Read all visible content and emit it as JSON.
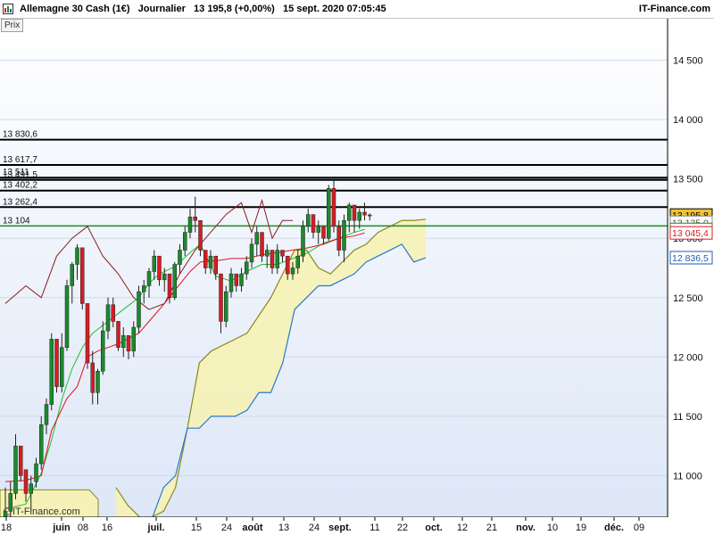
{
  "header": {
    "instrument": "Allemagne 30 Cash (1€)",
    "period": "Journalier",
    "quote": "13 195,8 (+0,00%)",
    "datetime": "15 sept. 2020 07:05:45",
    "brand": "IT-Finance.com"
  },
  "panel_label": "Prix",
  "watermark": "IT-Finance.com",
  "colors": {
    "background_top": "#ffffff",
    "background_bottom": "#dde7f7",
    "candle_up": "#1b8a2c",
    "candle_down": "#d81c22",
    "wick": "#222222",
    "tenkan": "#e3101e",
    "kijun": "#1fbf2e",
    "chikou": "#8b1c1c",
    "senkou_a": "#888a1d",
    "senkou_b": "#2878d0",
    "cloud_fill": "#f6f1b8",
    "level_line": "#000000",
    "green_level": "#1f8a1f"
  },
  "chart_data": {
    "type": "candlestick",
    "indicator": "Ichimoku",
    "y_axis": {
      "range": [
        10650,
        14850
      ],
      "ticks": [
        11000,
        11500,
        12000,
        12500,
        13000,
        13500,
        14000,
        14500
      ]
    },
    "x_axis": {
      "ticks": [
        {
          "label": "18",
          "bold": false
        },
        {
          "label": "juin",
          "bold": true
        },
        {
          "label": "08",
          "bold": false
        },
        {
          "label": "16",
          "bold": false
        },
        {
          "label": "juil.",
          "bold": true
        },
        {
          "label": "15",
          "bold": false
        },
        {
          "label": "24",
          "bold": false
        },
        {
          "label": "août",
          "bold": true
        },
        {
          "label": "13",
          "bold": false
        },
        {
          "label": "24",
          "bold": false
        },
        {
          "label": "sept.",
          "bold": true
        },
        {
          "label": "11",
          "bold": false
        },
        {
          "label": "22",
          "bold": false
        },
        {
          "label": "oct.",
          "bold": true
        },
        {
          "label": "12",
          "bold": false
        },
        {
          "label": "21",
          "bold": false
        },
        {
          "label": "nov.",
          "bold": true
        },
        {
          "label": "10",
          "bold": false
        },
        {
          "label": "19",
          "bold": false
        },
        {
          "label": "déc.",
          "bold": true
        },
        {
          "label": "09",
          "bold": false
        }
      ]
    },
    "horizontal_levels": [
      {
        "label": "13 830,6",
        "value": 13830.6,
        "color": "#000000"
      },
      {
        "label": "13 617,7",
        "value": 13617.7,
        "color": "#000000"
      },
      {
        "label": "13 511",
        "value": 13511,
        "color": "#000000"
      },
      {
        "label": "13 491,5",
        "value": 13491.5,
        "color": "#000000"
      },
      {
        "label": "13 402,2",
        "value": 13402.2,
        "color": "#000000"
      },
      {
        "label": "13 262,4",
        "value": 13262.4,
        "color": "#000000"
      },
      {
        "label": "13 104",
        "value": 13104,
        "color": "#1f8a1f"
      }
    ],
    "price_badges": [
      {
        "label": "13 195,8",
        "value": 13195.8,
        "bg": "#f2c230",
        "fg": "#000000",
        "border": "#000000"
      },
      {
        "label": "13 135,0",
        "value": 13135,
        "bg": "#ffffff",
        "fg": "#555555",
        "border": "#888888"
      },
      {
        "label": "13 074,7",
        "value": 13074.7,
        "bg": "#ffffff",
        "fg": "#1f8a1f",
        "border": "#1f8a1f"
      },
      {
        "label": "13 045,4",
        "value": 13045.4,
        "bg": "#ffffff",
        "fg": "#d81c22",
        "border": "#d81c22"
      },
      {
        "label": "12 836,5",
        "value": 12836.5,
        "bg": "#ffffff",
        "fg": "#1d5fb8",
        "border": "#1d5fb8"
      }
    ],
    "candles": [
      [
        10650,
        10900,
        10400,
        10700
      ],
      [
        10700,
        10950,
        10650,
        10850
      ],
      [
        10850,
        11350,
        10800,
        11250
      ],
      [
        11250,
        11200,
        10950,
        11000
      ],
      [
        11050,
        11000,
        10780,
        10850
      ],
      [
        10850,
        11000,
        10700,
        10930
      ],
      [
        10950,
        11150,
        10900,
        11100
      ],
      [
        11100,
        11500,
        11050,
        11430
      ],
      [
        11430,
        11650,
        11350,
        11600
      ],
      [
        11600,
        12200,
        11550,
        12150
      ],
      [
        12150,
        12100,
        11700,
        11750
      ],
      [
        11750,
        12200,
        11700,
        12080
      ],
      [
        12080,
        12650,
        12050,
        12600
      ],
      [
        12600,
        12800,
        12450,
        12780
      ],
      [
        12780,
        12950,
        12650,
        12920
      ],
      [
        12920,
        12550,
        12400,
        12450
      ],
      [
        12450,
        12200,
        11900,
        11950
      ],
      [
        11950,
        12050,
        11600,
        11700
      ],
      [
        11700,
        11900,
        11600,
        11880
      ],
      [
        11880,
        12300,
        11850,
        12220
      ],
      [
        12220,
        12500,
        12150,
        12440
      ],
      [
        12440,
        12500,
        12250,
        12300
      ],
      [
        12300,
        12200,
        12050,
        12080
      ],
      [
        12080,
        12250,
        12000,
        12180
      ],
      [
        12180,
        12150,
        11980,
        12050
      ],
      [
        12050,
        12300,
        12000,
        12250
      ],
      [
        12250,
        12600,
        12200,
        12550
      ],
      [
        12550,
        12650,
        12450,
        12600
      ],
      [
        12600,
        12750,
        12500,
        12720
      ],
      [
        12720,
        12900,
        12650,
        12850
      ],
      [
        12850,
        12800,
        12600,
        12650
      ],
      [
        12650,
        12750,
        12550,
        12700
      ],
      [
        12700,
        12550,
        12450,
        12500
      ],
      [
        12500,
        12800,
        12480,
        12780
      ],
      [
        12780,
        12950,
        12700,
        12900
      ],
      [
        12900,
        13100,
        12850,
        13050
      ],
      [
        13050,
        13250,
        13000,
        13180
      ],
      [
        13180,
        13350,
        13050,
        13150
      ],
      [
        13150,
        12950,
        12850,
        12900
      ],
      [
        12900,
        12800,
        12700,
        12750
      ],
      [
        12750,
        12900,
        12700,
        12850
      ],
      [
        12850,
        12750,
        12650,
        12700
      ],
      [
        12700,
        12350,
        12200,
        12300
      ],
      [
        12300,
        12600,
        12250,
        12550
      ],
      [
        12550,
        12750,
        12500,
        12700
      ],
      [
        12700,
        12650,
        12550,
        12600
      ],
      [
        12600,
        12750,
        12550,
        12700
      ],
      [
        12700,
        12850,
        12650,
        12800
      ],
      [
        12800,
        13000,
        12750,
        12950
      ],
      [
        12950,
        13100,
        12850,
        13050
      ],
      [
        13050,
        12900,
        12800,
        12850
      ],
      [
        12850,
        12950,
        12750,
        12900
      ],
      [
        12900,
        12800,
        12700,
        12750
      ],
      [
        12750,
        12950,
        12700,
        12900
      ],
      [
        12900,
        12850,
        12800,
        12850
      ],
      [
        12850,
        12800,
        12650,
        12700
      ],
      [
        12700,
        12800,
        12650,
        12750
      ],
      [
        12750,
        12900,
        12700,
        12850
      ],
      [
        12850,
        13150,
        12800,
        13100
      ],
      [
        13100,
        13250,
        13050,
        13200
      ],
      [
        13200,
        13150,
        13000,
        13050
      ],
      [
        13050,
        13150,
        12950,
        13100
      ],
      [
        13100,
        13050,
        12950,
        13000
      ],
      [
        13000,
        13450,
        12980,
        13420
      ],
      [
        13420,
        13500,
        13050,
        13100
      ],
      [
        13100,
        13150,
        12850,
        12900
      ],
      [
        12900,
        13200,
        12800,
        13150
      ],
      [
        13150,
        13300,
        13050,
        13280
      ],
      [
        13280,
        13100,
        13050,
        13150
      ],
      [
        13150,
        13250,
        13080,
        13220
      ],
      [
        13220,
        13300,
        13150,
        13196
      ],
      [
        13196,
        13210,
        13150,
        13196
      ]
    ],
    "tenkan": [
      [
        0,
        10950
      ],
      [
        4,
        10960
      ],
      [
        7,
        11000
      ],
      [
        9,
        11380
      ],
      [
        12,
        11650
      ],
      [
        14,
        11750
      ],
      [
        16,
        12000
      ],
      [
        18,
        12050
      ],
      [
        20,
        12080
      ],
      [
        22,
        12110
      ],
      [
        26,
        12200
      ],
      [
        29,
        12350
      ],
      [
        31,
        12450
      ],
      [
        33,
        12560
      ],
      [
        36,
        12720
      ],
      [
        38,
        12800
      ],
      [
        41,
        12810
      ],
      [
        44,
        12830
      ],
      [
        47,
        12830
      ],
      [
        50,
        12860
      ],
      [
        53,
        12880
      ],
      [
        56,
        12900
      ],
      [
        59,
        12920
      ],
      [
        62,
        12950
      ],
      [
        65,
        13000
      ],
      [
        68,
        13020
      ],
      [
        70,
        13045
      ]
    ],
    "kijun": [
      [
        0,
        10720
      ],
      [
        4,
        10760
      ],
      [
        7,
        11020
      ],
      [
        9,
        11300
      ],
      [
        11,
        11640
      ],
      [
        13,
        11900
      ],
      [
        15,
        12080
      ],
      [
        17,
        12200
      ],
      [
        20,
        12300
      ],
      [
        23,
        12400
      ],
      [
        26,
        12500
      ],
      [
        28,
        12620
      ],
      [
        30,
        12700
      ],
      [
        33,
        12760
      ],
      [
        36,
        12880
      ],
      [
        38,
        12950
      ],
      [
        41,
        12680
      ],
      [
        44,
        12640
      ],
      [
        47,
        12720
      ],
      [
        50,
        12780
      ],
      [
        53,
        12780
      ],
      [
        56,
        12830
      ],
      [
        59,
        12880
      ],
      [
        62,
        12960
      ],
      [
        65,
        13000
      ],
      [
        68,
        13050
      ],
      [
        70,
        13075
      ]
    ],
    "chikou": [
      [
        0,
        12450
      ],
      [
        4,
        12600
      ],
      [
        7,
        12500
      ],
      [
        10,
        12850
      ],
      [
        13,
        13000
      ],
      [
        16,
        13100
      ],
      [
        19,
        12850
      ],
      [
        22,
        12700
      ],
      [
        25,
        12500
      ],
      [
        28,
        12400
      ],
      [
        31,
        12450
      ],
      [
        34,
        12700
      ],
      [
        37,
        12900
      ],
      [
        40,
        13050
      ],
      [
        43,
        13200
      ],
      [
        46,
        13300
      ],
      [
        48,
        13050
      ],
      [
        50,
        13320
      ],
      [
        52,
        13000
      ],
      [
        54,
        13150
      ],
      [
        56,
        13150
      ]
    ],
    "senkou_a": [
      [
        0,
        10900
      ],
      [
        3,
        10750
      ],
      [
        6,
        10650
      ],
      [
        9,
        10650
      ],
      [
        12,
        10700
      ],
      [
        15,
        10900
      ],
      [
        18,
        11400
      ],
      [
        21,
        11950
      ],
      [
        24,
        12050
      ],
      [
        27,
        12100
      ],
      [
        30,
        12150
      ],
      [
        33,
        12200
      ],
      [
        36,
        12350
      ],
      [
        39,
        12500
      ],
      [
        42,
        12700
      ],
      [
        45,
        12900
      ],
      [
        48,
        12900
      ],
      [
        51,
        12750
      ],
      [
        54,
        12700
      ],
      [
        57,
        12800
      ],
      [
        60,
        12900
      ],
      [
        63,
        12950
      ],
      [
        66,
        13050
      ],
      [
        69,
        13100
      ],
      [
        72,
        13150
      ],
      [
        75,
        13150
      ],
      [
        78,
        13160
      ]
    ],
    "senkou_b": [
      [
        0,
        10650
      ],
      [
        3,
        10600
      ],
      [
        6,
        10600
      ],
      [
        9,
        10630
      ],
      [
        12,
        10900
      ],
      [
        15,
        11000
      ],
      [
        18,
        11400
      ],
      [
        21,
        11400
      ],
      [
        24,
        11500
      ],
      [
        27,
        11500
      ],
      [
        30,
        11500
      ],
      [
        33,
        11550
      ],
      [
        36,
        11700
      ],
      [
        39,
        11700
      ],
      [
        42,
        11950
      ],
      [
        45,
        12400
      ],
      [
        48,
        12500
      ],
      [
        51,
        12600
      ],
      [
        54,
        12600
      ],
      [
        57,
        12650
      ],
      [
        60,
        12700
      ],
      [
        63,
        12800
      ],
      [
        66,
        12850
      ],
      [
        69,
        12900
      ],
      [
        72,
        12950
      ],
      [
        75,
        12800
      ],
      [
        78,
        12836
      ]
    ]
  }
}
